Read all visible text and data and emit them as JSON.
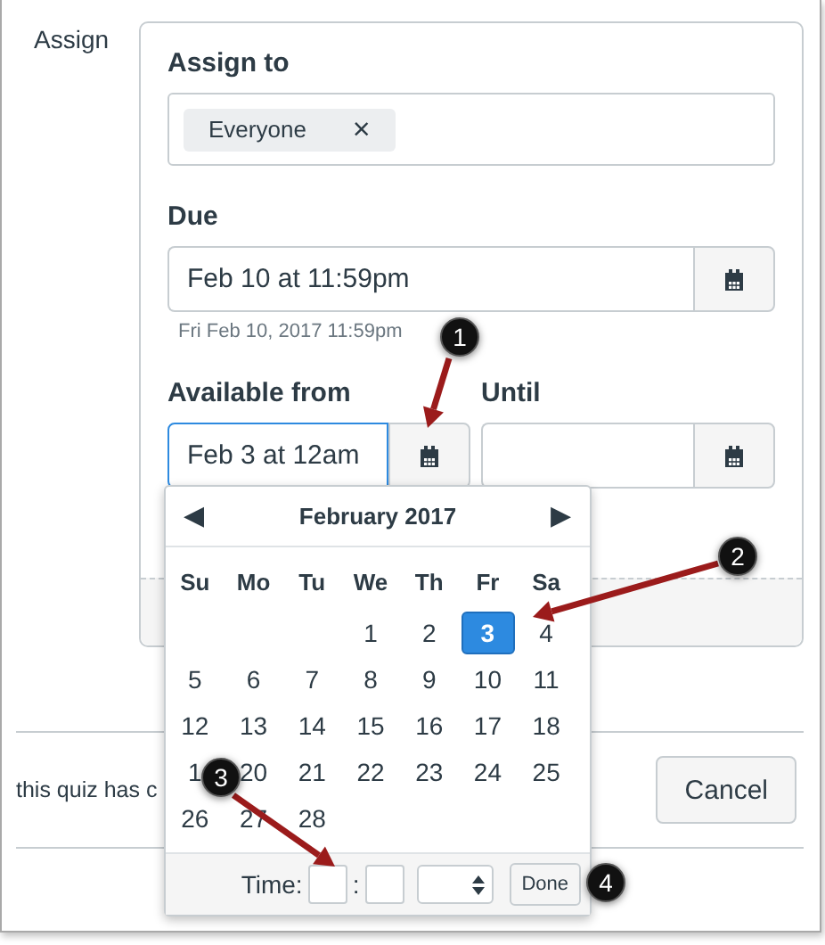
{
  "section_label": "Assign",
  "assign_to": {
    "label": "Assign to",
    "tokens": [
      {
        "text": "Everyone",
        "remove": "×"
      }
    ]
  },
  "due": {
    "label": "Due",
    "value": "Feb 10 at 11:59pm",
    "hint": "Fri Feb 10, 2017 11:59pm"
  },
  "available_from": {
    "label": "Available from",
    "value": "Feb 3 at 12am",
    "focused": true
  },
  "until": {
    "label": "Until",
    "focused": false
  },
  "quiz_note": "this quiz has c",
  "cancel": "Cancel",
  "calendar": {
    "prev": "◀",
    "next": "▶",
    "month": "February 2017",
    "weekdays": [
      "Su",
      "Mo",
      "Tu",
      "We",
      "Th",
      "Fr",
      "Sa"
    ],
    "weeks": [
      [
        {
          "text": "1",
          "selected": false
        },
        {
          "text": "2",
          "selected": false
        },
        {
          "text": "3",
          "selected": true
        },
        {
          "text": "4",
          "selected": false
        }
      ],
      [
        {
          "text": "5",
          "selected": false
        },
        {
          "text": "6",
          "selected": false
        },
        {
          "text": "7",
          "selected": false
        },
        {
          "text": "8",
          "selected": false
        },
        {
          "text": "9",
          "selected": false
        },
        {
          "text": "10",
          "selected": false
        },
        {
          "text": "11",
          "selected": false
        }
      ],
      [
        {
          "text": "12",
          "selected": false
        },
        {
          "text": "13",
          "selected": false
        },
        {
          "text": "14",
          "selected": false
        },
        {
          "text": "15",
          "selected": false
        },
        {
          "text": "16",
          "selected": false
        },
        {
          "text": "17",
          "selected": false
        },
        {
          "text": "18",
          "selected": false
        }
      ],
      [
        {
          "text": "1",
          "selected": false
        },
        {
          "text": "20",
          "selected": false
        },
        {
          "text": "21",
          "selected": false
        },
        {
          "text": "22",
          "selected": false
        },
        {
          "text": "23",
          "selected": false
        },
        {
          "text": "24",
          "selected": false
        },
        {
          "text": "25",
          "selected": false
        }
      ],
      [
        {
          "text": "26",
          "selected": false
        },
        {
          "text": "27",
          "selected": false
        },
        {
          "text": "28",
          "selected": false
        }
      ]
    ],
    "time_label": "Time:",
    "time_separator": ":",
    "done": "Done"
  },
  "callouts": [
    "1",
    "2",
    "3",
    "4"
  ]
}
